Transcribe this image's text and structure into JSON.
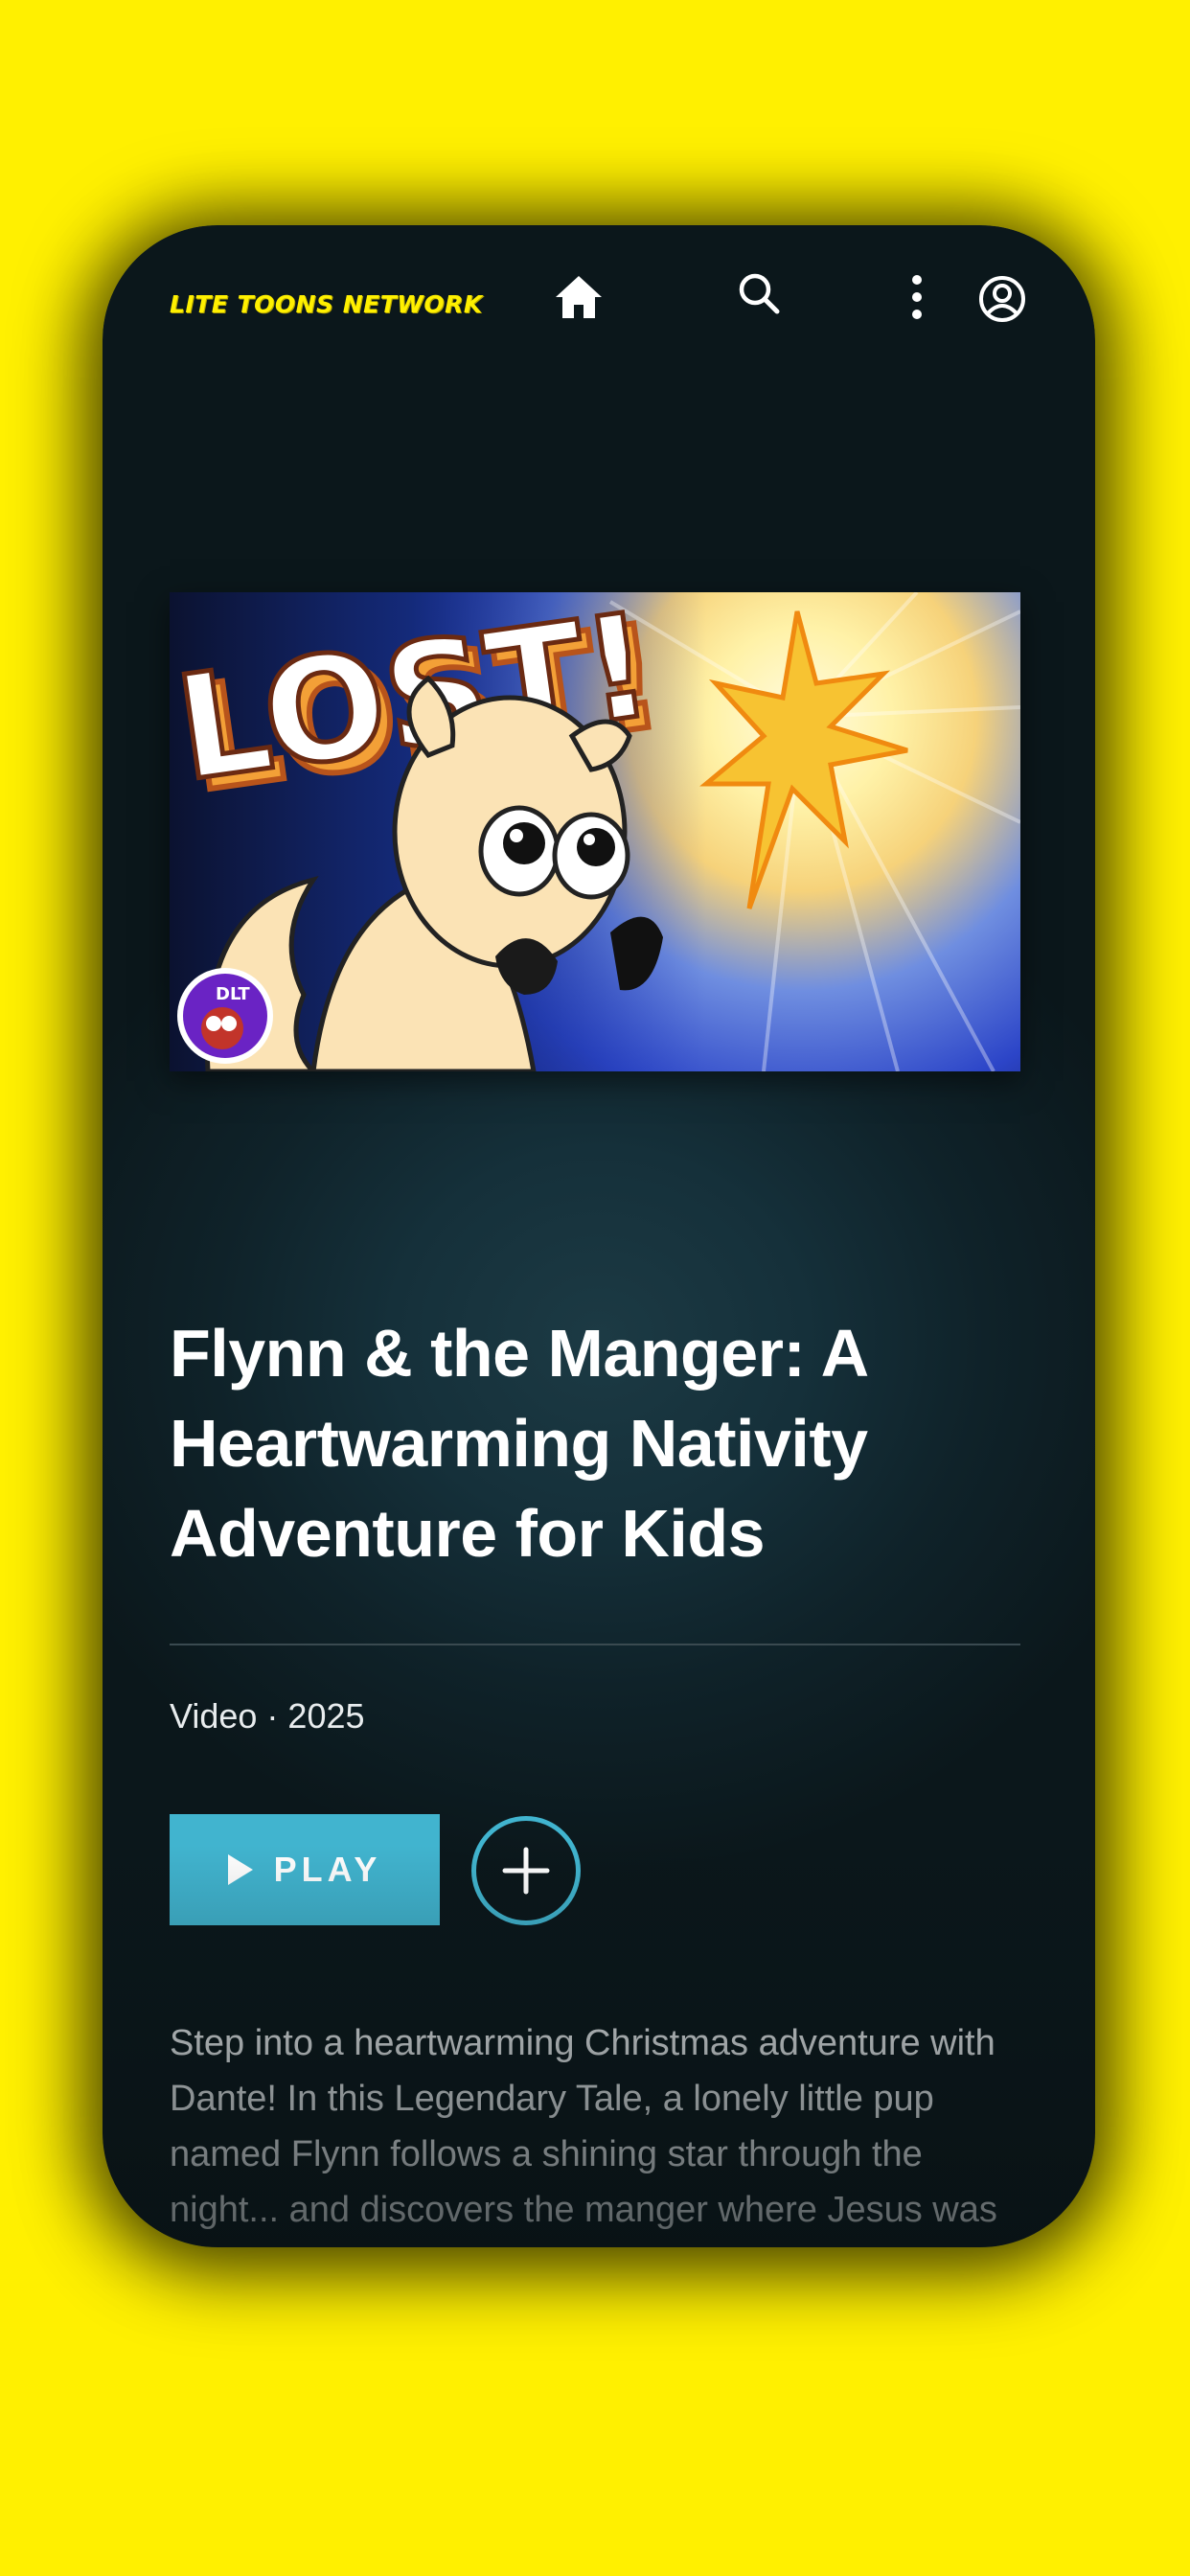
{
  "app": {
    "logo_text": "LITE TOONS NETWORK",
    "accent": "#41B4CF",
    "frame_bg": "#FFF000"
  },
  "nav": {
    "icons": [
      "home-icon",
      "search-icon",
      "more-vertical-icon",
      "account-icon"
    ]
  },
  "hero": {
    "thumbnail_text": "LOST!",
    "badge_text": "DLT"
  },
  "title": "Flynn & the Manger: A Heartwarming Nativity Adventure for Kids",
  "meta": "Video · 2025",
  "actions": {
    "play_label": "PLAY",
    "add_icon": "plus-icon"
  },
  "description": "Step into a heartwarming Christmas adventure with Dante! In this Legendary Tale, a lonely little pup named Flynn follows a shining star through the night... and discovers the manger where Jesus was born. Kids will love this"
}
